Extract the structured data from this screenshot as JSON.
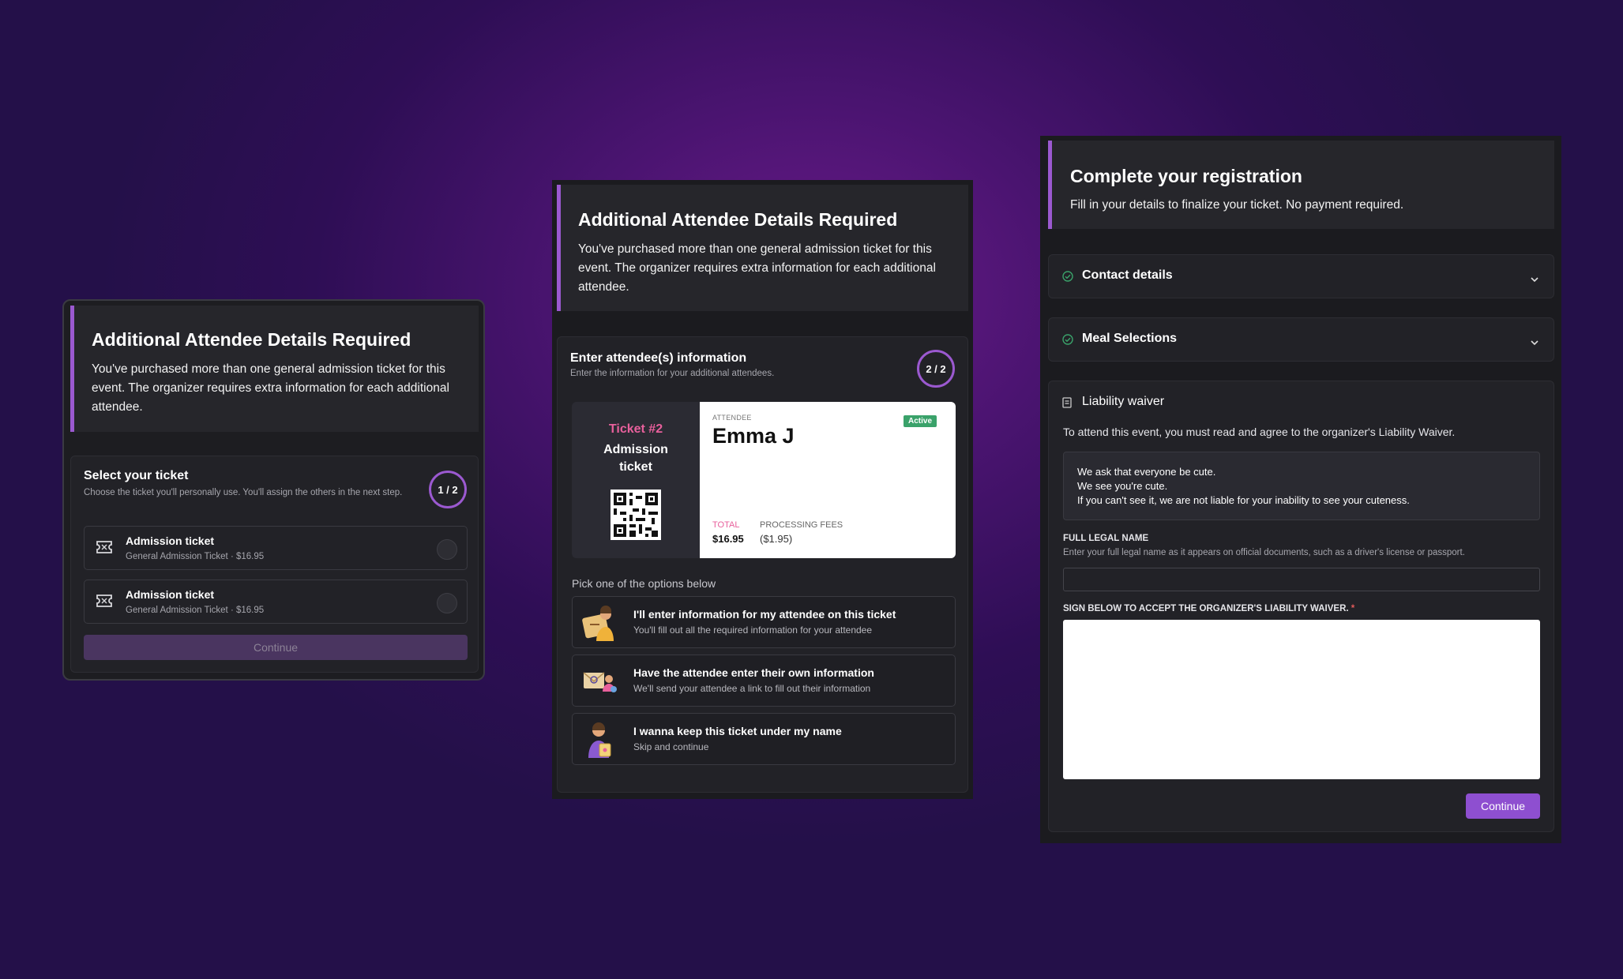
{
  "left": {
    "header": {
      "title": "Additional Attendee Details Required",
      "body": "You've purchased more than one general admission ticket for this event. The organizer requires extra information for each additional attendee."
    },
    "select": {
      "title": "Select your ticket",
      "subtitle": "Choose the ticket you'll personally use. You'll assign the others in the next step.",
      "step": "1 / 2",
      "tickets": [
        {
          "name": "Admission ticket",
          "desc": "General Admission Ticket · $16.95"
        },
        {
          "name": "Admission ticket",
          "desc": "General Admission Ticket · $16.95"
        }
      ],
      "continue_label": "Continue"
    }
  },
  "middle": {
    "header": {
      "title": "Additional Attendee Details Required",
      "body": "You've purchased more than one general admission ticket for this event. The organizer requires extra information for each additional attendee."
    },
    "enter": {
      "title": "Enter attendee(s) information",
      "subtitle": "Enter the information for your additional attendees.",
      "step": "2 / 2"
    },
    "ticket": {
      "number": "Ticket #2",
      "type_line1": "Admission",
      "type_line2": "ticket",
      "attendee_label": "ATTENDEE",
      "attendee_name": "Emma J",
      "badge": "Active",
      "total_label": "TOTAL",
      "total_value": "$16.95",
      "fees_label": "PROCESSING FEES",
      "fees_value": "($1.95)"
    },
    "options_prompt": "Pick one of the options below",
    "options": [
      {
        "title": "I'll enter information for my attendee on this ticket",
        "sub": "You'll fill out all the required information for your attendee",
        "icon": "person-writing-icon"
      },
      {
        "title": "Have the attendee enter their own information",
        "sub": "We'll send your attendee a link to fill out their information",
        "icon": "send-link-icon"
      },
      {
        "title": "I wanna keep this ticket under my name",
        "sub": "Skip and continue",
        "icon": "person-ticket-icon"
      }
    ]
  },
  "right": {
    "header": {
      "title": "Complete your registration",
      "body": "Fill in your details to finalize your ticket. No payment required."
    },
    "sections": [
      {
        "title": "Contact details"
      },
      {
        "title": "Meal Selections"
      }
    ],
    "waiver": {
      "title": "Liability waiver",
      "intro": "To attend this event, you must read and agree to the organizer's Liability Waiver.",
      "text_lines": [
        "We ask that everyone be cute.",
        "We see you're cute.",
        "If you can't see it, we are not liable for your inability to see your cuteness."
      ],
      "name_label": "FULL LEGAL NAME",
      "name_help": "Enter your full legal name as it appears on official documents, such as a driver's license or passport.",
      "name_value": "",
      "sign_label": "SIGN BELOW TO ACCEPT THE ORGANIZER'S LIABILITY WAIVER.",
      "required_mark": "*",
      "continue_label": "Continue"
    }
  },
  "colors": {
    "accent": "#9b59d0",
    "active_badge": "#3aa26a",
    "ticket_pink": "#e8609c"
  }
}
